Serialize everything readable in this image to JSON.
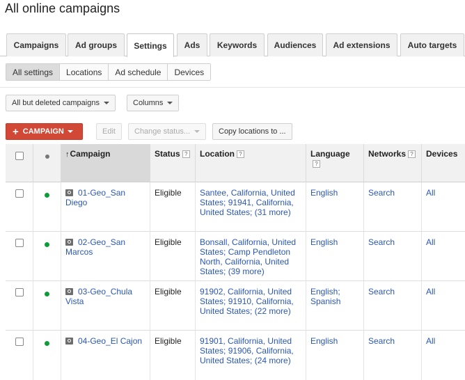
{
  "page": {
    "title": "All online campaigns"
  },
  "tabs": [
    {
      "label": "Campaigns"
    },
    {
      "label": "Ad groups"
    },
    {
      "label": "Settings"
    },
    {
      "label": "Ads"
    },
    {
      "label": "Keywords"
    },
    {
      "label": "Audiences"
    },
    {
      "label": "Ad extensions"
    },
    {
      "label": "Auto targets"
    }
  ],
  "subtabs": [
    {
      "label": "All settings"
    },
    {
      "label": "Locations"
    },
    {
      "label": "Ad schedule"
    },
    {
      "label": "Devices"
    }
  ],
  "filters": {
    "campaign_filter": "All but deleted campaigns",
    "columns": "Columns"
  },
  "toolbar": {
    "add_campaign": "CAMPAIGN",
    "edit": "Edit",
    "change_status": "Change status...",
    "copy_locations": "Copy locations to ..."
  },
  "table": {
    "headers": {
      "campaign": "Campaign",
      "status": "Status",
      "location": "Location",
      "language": "Language",
      "networks": "Networks",
      "devices": "Devices"
    },
    "rows": [
      {
        "campaign": "01-Geo_San Diego",
        "status": "Eligible",
        "location": "Santee, California, United States; 91941, California, United States; (31 more)",
        "language": "English",
        "networks": "Search",
        "devices": "All"
      },
      {
        "campaign": "02-Geo_San Marcos",
        "status": "Eligible",
        "location": "Bonsall, California, United States; Camp Pendleton North, California, United States; (39 more)",
        "language": "English",
        "networks": "Search",
        "devices": "All"
      },
      {
        "campaign": "03-Geo_Chula Vista",
        "status": "Eligible",
        "location": "91902, California, United States; 91910, California, United States; (22 more)",
        "language": "English; Spanish",
        "networks": "Search",
        "devices": "All"
      },
      {
        "campaign": "04-Geo_El Cajon",
        "status": "Eligible",
        "location": "91901, California, United States; 91906, California, United States; (24 more)",
        "language": "English",
        "networks": "Search",
        "devices": "All"
      }
    ]
  },
  "colors": {
    "accent_red": "#d14836",
    "link_blue": "#2a57b6",
    "status_green": "#109b39"
  },
  "icons": [
    "plus-icon",
    "caret-down-icon",
    "sort-up-icon",
    "help-icon",
    "campaign-icon",
    "status-dot-icon"
  ]
}
